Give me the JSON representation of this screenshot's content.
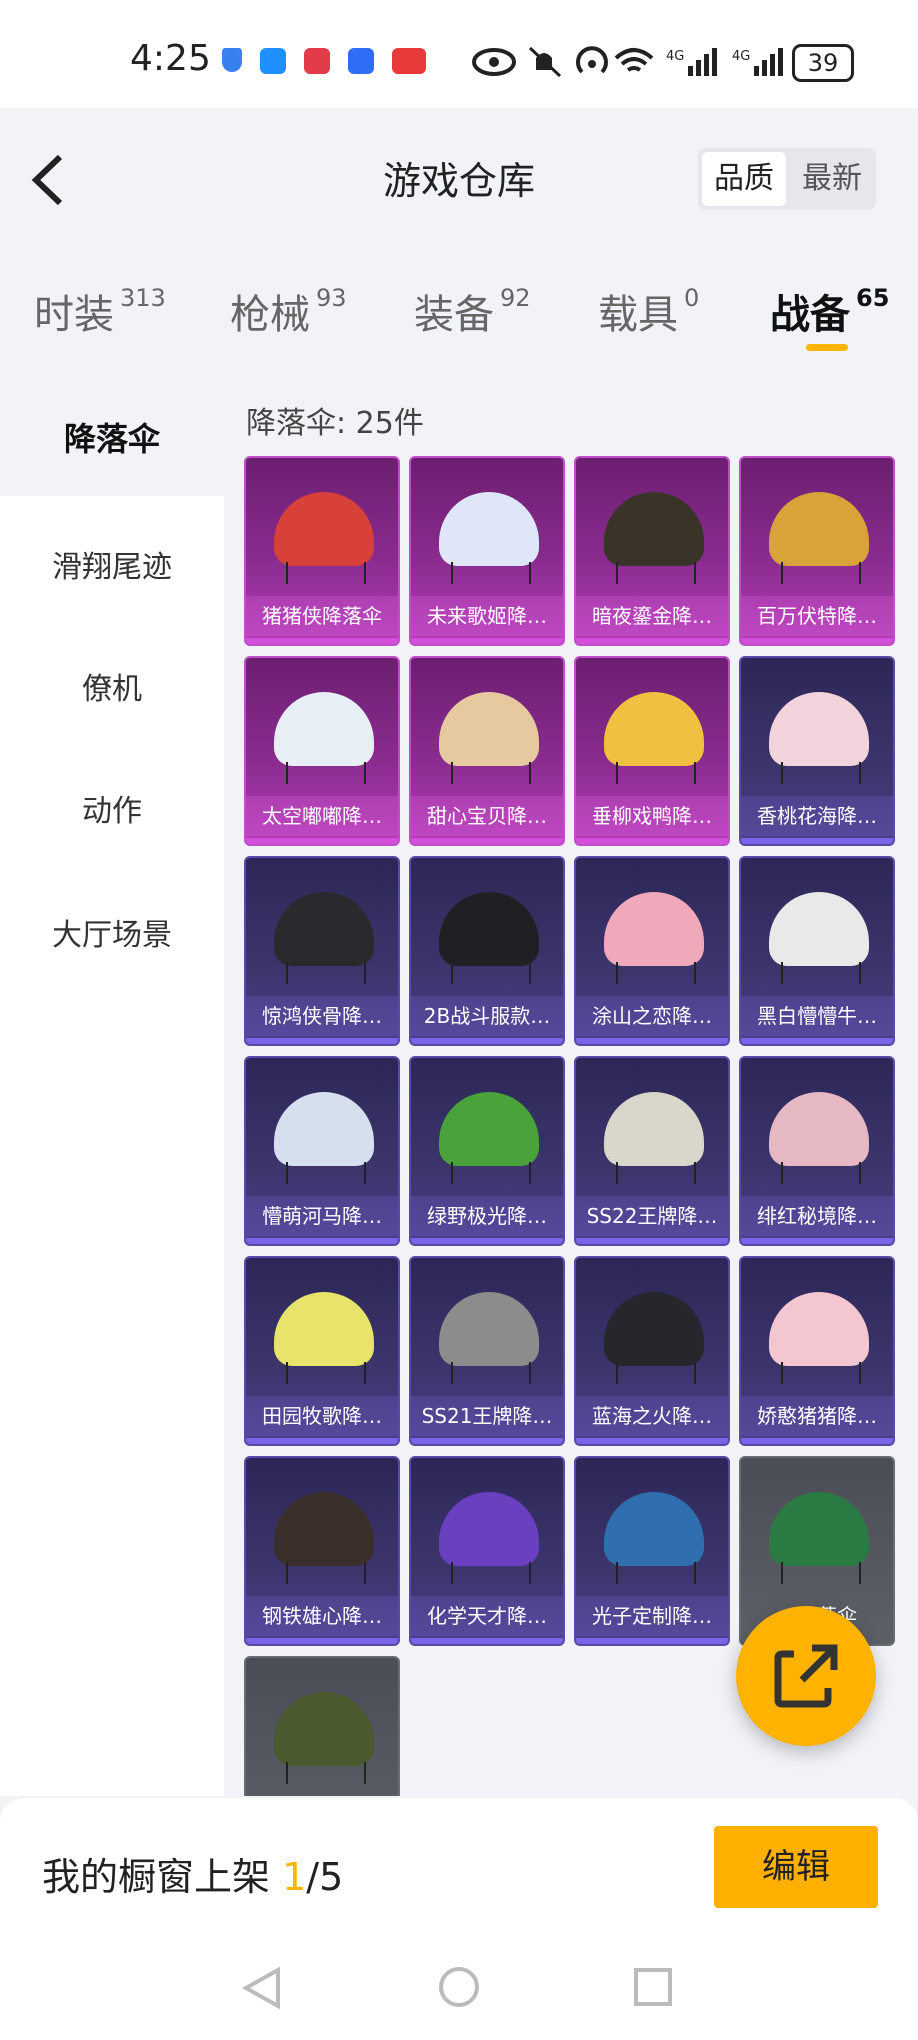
{
  "status_bar": {
    "time": "4:25",
    "battery": "39"
  },
  "header": {
    "title": "游戏仓库",
    "sort_quality": "品质",
    "sort_newest": "最新"
  },
  "tabs": [
    {
      "label": "时装",
      "count": "313"
    },
    {
      "label": "枪械",
      "count": "93"
    },
    {
      "label": "装备",
      "count": "92"
    },
    {
      "label": "载具",
      "count": "0"
    },
    {
      "label": "战备",
      "count": "65",
      "active": true
    }
  ],
  "sidebar": {
    "items": [
      "降落伞",
      "滑翔尾迹",
      "僚机",
      "动作",
      "大厅场景"
    ]
  },
  "main": {
    "count_label": "降落伞: 25件",
    "items": [
      {
        "name": "猪猪侠降落伞",
        "rarity": "pink",
        "color": "#d8413a"
      },
      {
        "name": "未来歌姬降…",
        "rarity": "pink",
        "color": "#dfe6f7"
      },
      {
        "name": "暗夜鎏金降…",
        "rarity": "pink",
        "color": "#3a3428"
      },
      {
        "name": "百万伏特降…",
        "rarity": "pink",
        "color": "#d9a33a"
      },
      {
        "name": "太空嘟嘟降…",
        "rarity": "pink",
        "color": "#e8eef6"
      },
      {
        "name": "甜心宝贝降…",
        "rarity": "pink",
        "color": "#e7c9a0"
      },
      {
        "name": "垂柳戏鸭降…",
        "rarity": "pink",
        "color": "#f0c040"
      },
      {
        "name": "香桃花海降…",
        "rarity": "purple",
        "color": "#f3d4dc"
      },
      {
        "name": "惊鸿侠骨降…",
        "rarity": "purple",
        "color": "#2a2a2e"
      },
      {
        "name": "2B战斗服款…",
        "rarity": "purple",
        "color": "#1f2023"
      },
      {
        "name": "涂山之恋降…",
        "rarity": "purple",
        "color": "#f0a8bb"
      },
      {
        "name": "黑白懵懵牛…",
        "rarity": "purple",
        "color": "#e9e9e9"
      },
      {
        "name": "懵萌河马降…",
        "rarity": "purple",
        "color": "#d5dfee"
      },
      {
        "name": "绿野极光降…",
        "rarity": "purple",
        "color": "#4aa23a"
      },
      {
        "name": "SS22王牌降…",
        "rarity": "purple",
        "color": "#d9d6cc"
      },
      {
        "name": "绯红秘境降…",
        "rarity": "purple",
        "color": "#e6b8c4"
      },
      {
        "name": "田园牧歌降…",
        "rarity": "purple",
        "color": "#e8e36a"
      },
      {
        "name": "SS21王牌降…",
        "rarity": "purple",
        "color": "#8c8c8c"
      },
      {
        "name": "蓝海之火降…",
        "rarity": "purple",
        "color": "#27262c"
      },
      {
        "name": "娇憨猪猪降…",
        "rarity": "purple",
        "color": "#f4c6cf"
      },
      {
        "name": "钢铁雄心降…",
        "rarity": "purple",
        "color": "#3a2f2a"
      },
      {
        "name": "化学天才降…",
        "rarity": "purple",
        "color": "#6a3fc0"
      },
      {
        "name": "光子定制降…",
        "rarity": "purple",
        "color": "#2f6fb0"
      },
      {
        "name": "…降落伞",
        "rarity": "gray",
        "color": "#2a7a44"
      },
      {
        "name": "",
        "rarity": "gray",
        "color": "#4a5a2e"
      }
    ]
  },
  "bottom": {
    "showcase_label": "我的橱窗上架",
    "showcase_current": "1",
    "showcase_total": "/5",
    "edit_label": "编辑"
  }
}
